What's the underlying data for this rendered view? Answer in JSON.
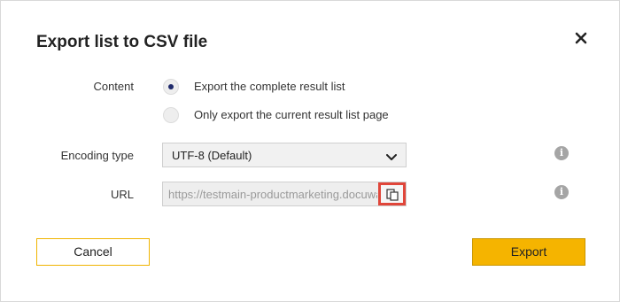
{
  "dialog": {
    "title": "Export list to CSV file",
    "close_icon": "close-icon"
  },
  "content": {
    "label": "Content",
    "options": [
      {
        "label": "Export the complete result list",
        "selected": true
      },
      {
        "label": "Only export the current result list page",
        "selected": false
      }
    ]
  },
  "encoding": {
    "label": "Encoding type",
    "value": "UTF-8 (Default)",
    "icon": "chevron-down-icon"
  },
  "url": {
    "label": "URL",
    "value": "https://testmain-productmarketing.docuware",
    "copy_icon": "copy-icon"
  },
  "info_icon": {
    "glyph": "i"
  },
  "buttons": {
    "cancel": "Cancel",
    "export": "Export"
  },
  "colors": {
    "accent": "#f5b400",
    "highlight": "#e0463a",
    "radio_selected": "#1f2a6b"
  }
}
